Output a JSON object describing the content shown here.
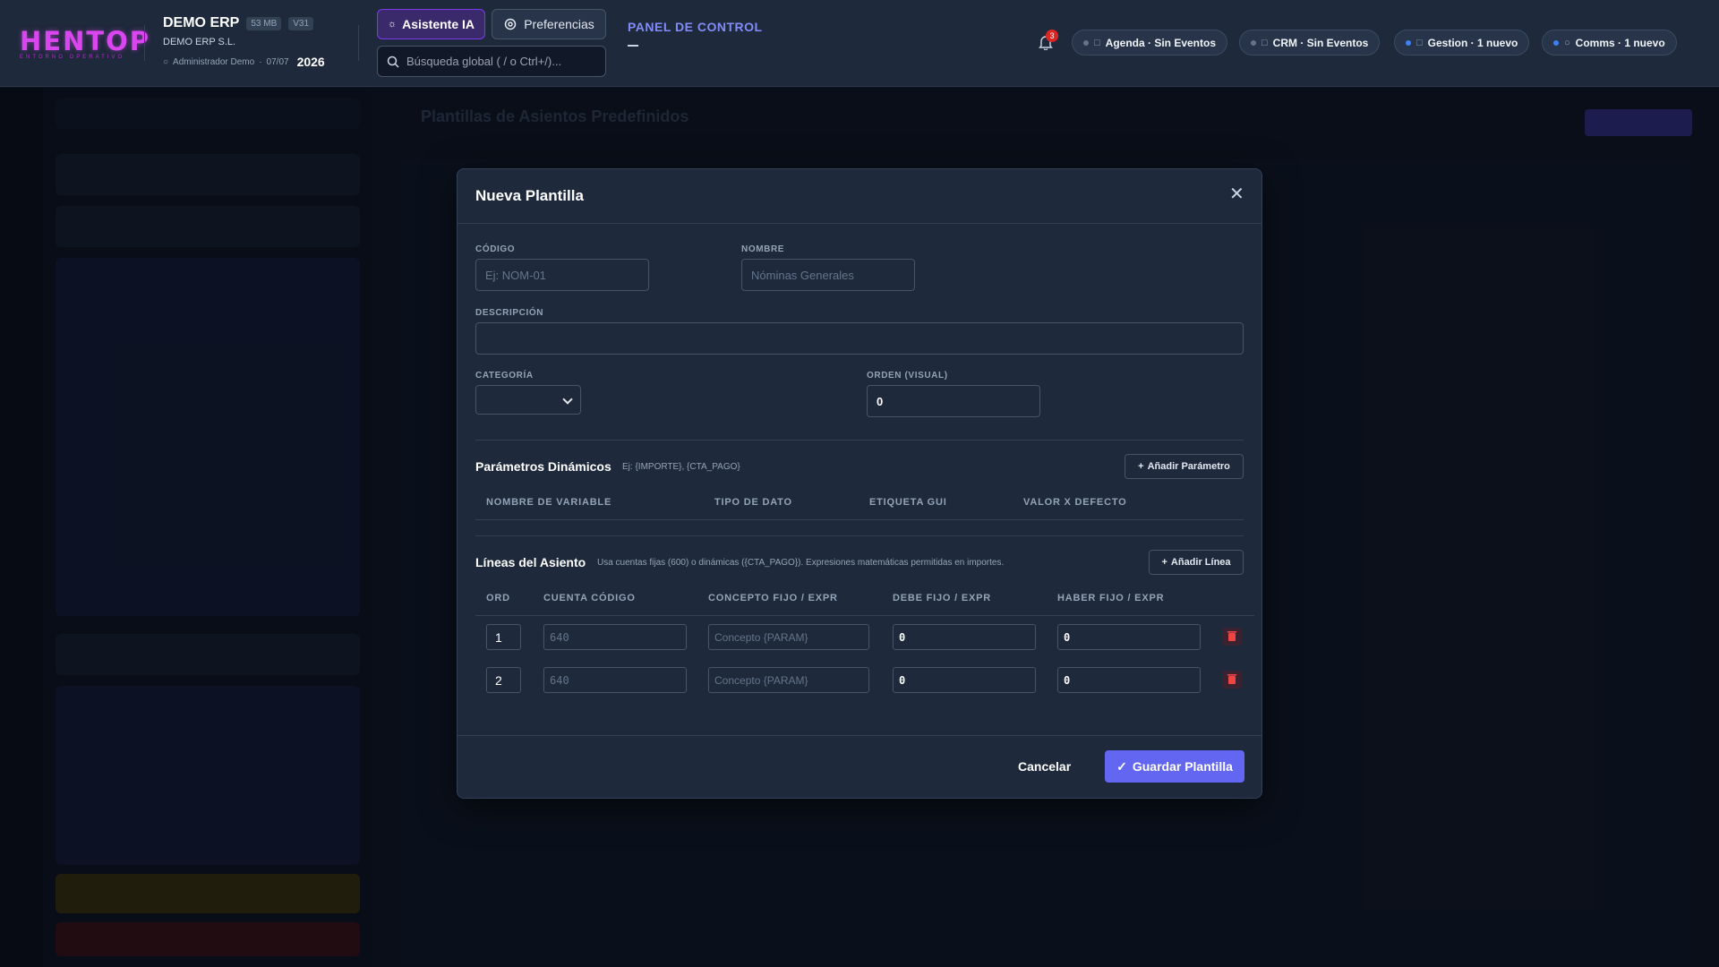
{
  "header": {
    "logo_text": "HENTOP",
    "logo_sub": "ENTORNO OPERATIVO",
    "company": "DEMO ERP",
    "size_badge": "53 MB",
    "version_badge": "V31",
    "company_full": "DEMO ERP S.L.",
    "user": "Administrador Demo",
    "date": "07/07",
    "year": "2026",
    "ai_button": "Asistente IA",
    "prefs_button": "Preferencias",
    "search_placeholder": "Búsqueda global ( / o Ctrl+/)...",
    "panel_title": "PANEL DE CONTROL",
    "notifications_count": "3",
    "chips": [
      {
        "label": "Agenda · Sin Eventos",
        "dot": "#64748b"
      },
      {
        "label": "CRM · Sin Eventos",
        "dot": "#64748b"
      },
      {
        "label": "Gestion · 1 nuevo",
        "dot": "#3b82f6"
      },
      {
        "label": "Comms · 1 nuevo",
        "dot": "#3b82f6"
      }
    ]
  },
  "modal": {
    "title": "Nueva Plantilla",
    "codigo_label": "CÓDIGO",
    "codigo_placeholder": "Ej: NOM-01",
    "nombre_label": "NOMBRE",
    "nombre_placeholder": "Nóminas Generales",
    "descripcion_label": "DESCRIPCIÓN",
    "categoria_label": "CATEGORÍA",
    "orden_label": "ORDEN (VISUAL)",
    "orden_value": "0",
    "params_title": "Parámetros Dinámicos",
    "params_hint": "Ej: {IMPORTE}, {CTA_PAGO}",
    "add_param": "Añadir Parámetro",
    "param_cols": [
      "NOMBRE DE VARIABLE",
      "TIPO DE DATO",
      "ETIQUETA GUI",
      "VALOR X DEFECTO"
    ],
    "lines_title": "Líneas del Asiento",
    "lines_hint": "Usa cuentas fijas (600) o dinámicas ({CTA_PAGO}). Expresiones matemáticas permitidas en importes.",
    "add_line": "Añadir Línea",
    "line_cols": [
      "ORD",
      "CUENTA CÓDIGO",
      "CONCEPTO FIJO / EXPR",
      "DEBE FIJO / EXPR",
      "HABER FIJO / EXPR"
    ],
    "lines": [
      {
        "ord": "1",
        "cuenta_placeholder": "640",
        "concepto_placeholder": "Concepto {PARAM}",
        "debe": "0",
        "haber": "0"
      },
      {
        "ord": "2",
        "cuenta_placeholder": "640",
        "concepto_placeholder": "Concepto {PARAM}",
        "debe": "0",
        "haber": "0"
      }
    ],
    "cancel": "Cancelar",
    "save": "Guardar Plantilla"
  },
  "background": {
    "page_title": "Plantillas de Asientos Predefinidos"
  }
}
